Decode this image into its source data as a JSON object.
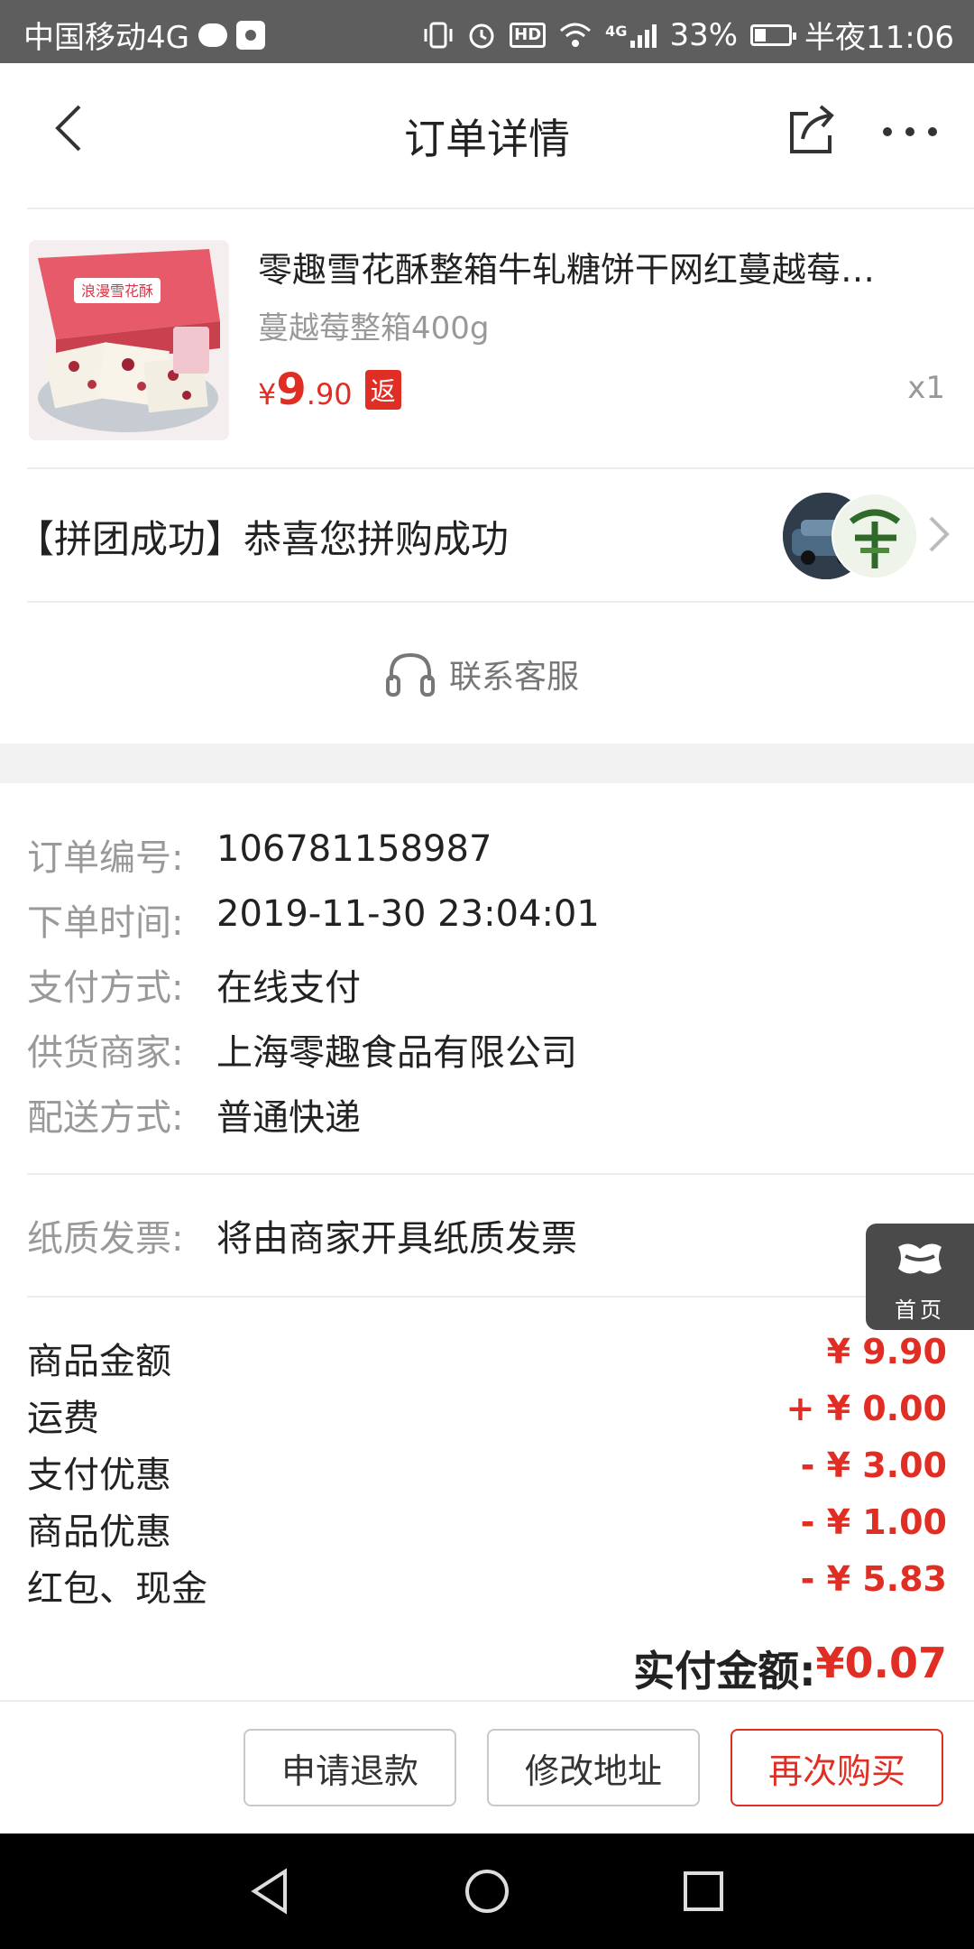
{
  "status_bar": {
    "carrier": "中国移动4G",
    "lte_label": "4G",
    "hd_label": "HD",
    "battery_percent": "33%",
    "battery_level": 0.33,
    "time": "半夜11:06"
  },
  "header": {
    "title": "订单详情"
  },
  "product": {
    "name": "零趣雪花酥整箱牛轧糖饼干网红蔓越莓…",
    "spec": "蔓越莓整箱400g",
    "price_symbol": "¥",
    "price_int": "9",
    "price_dec": ".90",
    "badge": "返",
    "quantity": "x1",
    "box_label": "浪漫雪花酥"
  },
  "group": {
    "text": "【拼团成功】恭喜您拼购成功"
  },
  "contact": {
    "label": "联系客服"
  },
  "order_info": [
    {
      "label": "订单编号:",
      "value": "106781158987"
    },
    {
      "label": "下单时间:",
      "value": "2019-11-30 23:04:01"
    },
    {
      "label": "支付方式:",
      "value": "在线支付"
    },
    {
      "label": "供货商家:",
      "value": "上海零趣食品有限公司"
    },
    {
      "label": "配送方式:",
      "value": "普通快递"
    }
  ],
  "invoice": {
    "label": "纸质发票:",
    "value": "将由商家开具纸质发票"
  },
  "amounts": [
    {
      "label": "商品金额",
      "value": "¥ 9.90"
    },
    {
      "label": "运费",
      "value": "+ ¥ 0.00"
    },
    {
      "label": "支付优惠",
      "value": "- ¥ 3.00"
    },
    {
      "label": "商品优惠",
      "value": "- ¥ 1.00"
    },
    {
      "label": "红包、现金",
      "value": "- ¥ 5.83"
    }
  ],
  "paid": {
    "label": "实付金额:",
    "value": "¥0.07"
  },
  "home_float": {
    "label": "首页"
  },
  "bottom_buttons": {
    "refund": "申请退款",
    "change_address": "修改地址",
    "buy_again": "再次购买"
  },
  "colors": {
    "accent": "#e02e24",
    "status_bar": "#5e5e5e",
    "gray_text": "#999999"
  }
}
